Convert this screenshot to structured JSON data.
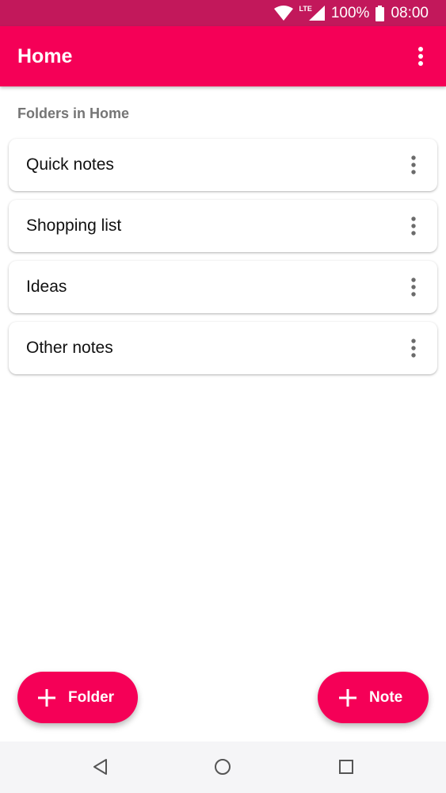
{
  "status_bar": {
    "network": "LTE",
    "battery": "100%",
    "time": "08:00"
  },
  "app_bar": {
    "title": "Home"
  },
  "section": {
    "label": "Folders in Home"
  },
  "folders": [
    {
      "name": "Quick notes"
    },
    {
      "name": "Shopping list"
    },
    {
      "name": "Ideas"
    },
    {
      "name": "Other notes"
    }
  ],
  "fabs": {
    "folder_label": "Folder",
    "note_label": "Note"
  },
  "colors": {
    "status_bar": "#c2185b",
    "accent": "#f50057",
    "section_text": "#757575",
    "nav_bar": "#f5f5f7"
  },
  "icons": {
    "status": [
      "wifi-icon",
      "signal-icon",
      "battery-icon"
    ],
    "app_bar": "more-vert-icon",
    "fab": "plus-icon",
    "nav": [
      "back-icon",
      "home-icon",
      "recents-icon"
    ]
  }
}
